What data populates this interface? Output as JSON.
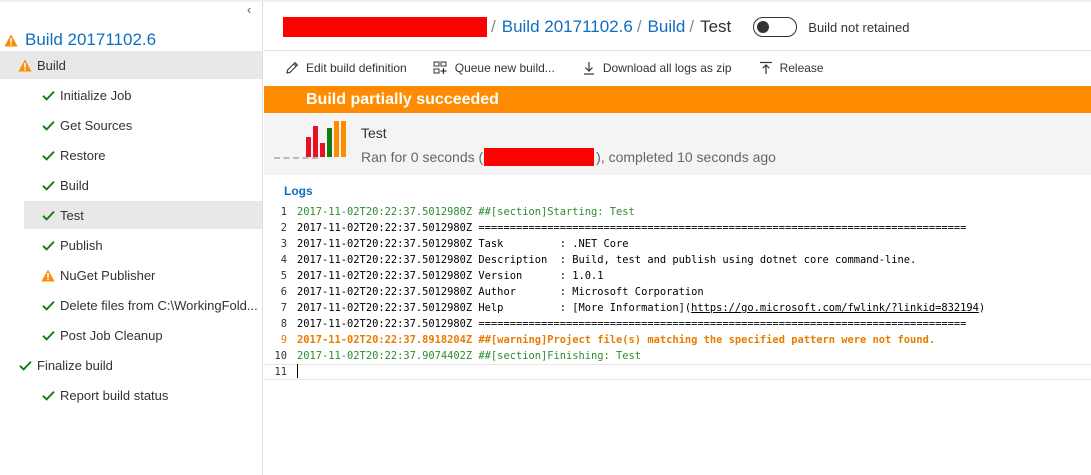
{
  "colors": {
    "accent": "#106ebe",
    "warning": "#ff8c00",
    "success": "#107c10",
    "banner_text": "#ffffff",
    "redaction": "#ff0000"
  },
  "sidebar": {
    "collapse_glyph": "‹",
    "build_title": "Build 20171102.6",
    "build_title_icon": "warning-icon",
    "items": [
      {
        "label": "Build",
        "status": "warning",
        "level": 0,
        "selected": true
      },
      {
        "label": "Initialize Job",
        "status": "success",
        "level": 1
      },
      {
        "label": "Get Sources",
        "status": "success",
        "level": 1
      },
      {
        "label": "Restore",
        "status": "success",
        "level": 1
      },
      {
        "label": "Build",
        "status": "success",
        "level": 1
      },
      {
        "label": "Test",
        "status": "success",
        "level": 1,
        "selected": true
      },
      {
        "label": "Publish",
        "status": "success",
        "level": 1
      },
      {
        "label": "NuGet Publisher",
        "status": "warning",
        "level": 1
      },
      {
        "label": "Delete files from C:\\WorkingFold...",
        "status": "success",
        "level": 1
      },
      {
        "label": "Post Job Cleanup",
        "status": "success",
        "level": 1
      },
      {
        "label": "Finalize build",
        "status": "success",
        "level": 0
      },
      {
        "label": "Report build status",
        "status": "success",
        "level": 1
      }
    ]
  },
  "header": {
    "breadcrumb": {
      "sep": "/",
      "build": "Build 20171102.6",
      "section": "Build",
      "current": "Test"
    },
    "retain_toggle": {
      "label": "Build not retained",
      "on": false
    }
  },
  "toolbar": {
    "edit_label": "Edit build definition",
    "edit_icon": "pencil-icon",
    "queue_label": "Queue new build...",
    "queue_icon": "queue-icon",
    "download_label": "Download all logs as zip",
    "download_icon": "download-icon",
    "release_label": "Release",
    "release_icon": "release-icon"
  },
  "status": {
    "banner": "Build partially succeeded",
    "title": "Test",
    "ran_prefix": "Ran for 0 seconds (",
    "ran_suffix": "), completed 10 seconds ago",
    "history_bars": [
      {
        "level": 0.55,
        "color": "#e81123"
      },
      {
        "level": 0.85,
        "color": "#e81123"
      },
      {
        "level": 0.4,
        "color": "#e81123"
      },
      {
        "level": 0.8,
        "color": "#107c10"
      },
      {
        "level": 1.0,
        "color": "#ff8c00"
      },
      {
        "level": 1.0,
        "color": "#ff8c00"
      }
    ]
  },
  "logs": {
    "title": "Logs",
    "lines": [
      {
        "n": "1",
        "text": "2017-11-02T20:22:37.5012980Z ##[section]Starting: Test",
        "kind": "section"
      },
      {
        "n": "2",
        "text": "2017-11-02T20:22:37.5012980Z ==============================================================================",
        "kind": "normal"
      },
      {
        "n": "3",
        "text": "2017-11-02T20:22:37.5012980Z Task         : .NET Core",
        "kind": "normal"
      },
      {
        "n": "4",
        "text": "2017-11-02T20:22:37.5012980Z Description  : Build, test and publish using dotnet core command-line.",
        "kind": "normal"
      },
      {
        "n": "5",
        "text": "2017-11-02T20:22:37.5012980Z Version      : 1.0.1",
        "kind": "normal"
      },
      {
        "n": "6",
        "text": "2017-11-02T20:22:37.5012980Z Author       : Microsoft Corporation",
        "kind": "normal"
      },
      {
        "n": "7",
        "text": "2017-11-02T20:22:37.5012980Z Help         : [More Information](",
        "link": "https://go.microsoft.com/fwlink/?linkid=832194",
        "after": ")",
        "kind": "normal"
      },
      {
        "n": "8",
        "text": "2017-11-02T20:22:37.5012980Z ==============================================================================",
        "kind": "normal"
      },
      {
        "n": "9",
        "text": "2017-11-02T20:22:37.8918204Z ##[warning]Project file(s) matching the specified pattern were not found.",
        "kind": "warn"
      },
      {
        "n": "10",
        "text": "2017-11-02T20:22:37.9074402Z ##[section]Finishing: Test",
        "kind": "section"
      },
      {
        "n": "11",
        "text": "",
        "kind": "cur"
      }
    ]
  }
}
